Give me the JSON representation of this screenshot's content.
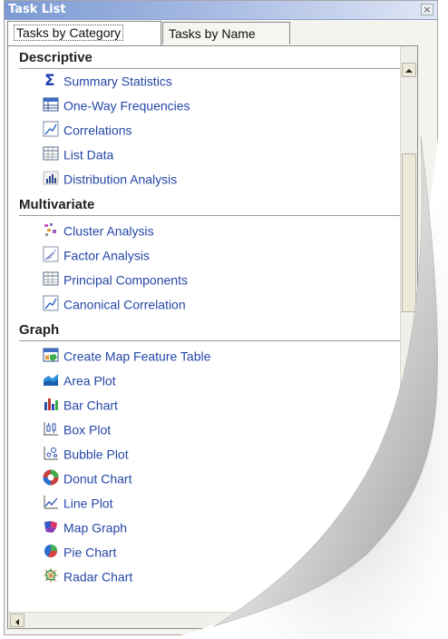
{
  "panel": {
    "title": "Task List",
    "close_glyph": "×"
  },
  "tabs": [
    {
      "label": "Tasks by Category",
      "active": true
    },
    {
      "label": "Tasks by Name",
      "active": false
    }
  ],
  "categories": [
    {
      "name": "Descriptive",
      "items": [
        {
          "label": "Summary Statistics",
          "icon": "sigma-icon"
        },
        {
          "label": "One-Way Frequencies",
          "icon": "table-icon"
        },
        {
          "label": "Correlations",
          "icon": "correlation-icon"
        },
        {
          "label": "List Data",
          "icon": "list-data-icon"
        },
        {
          "label": "Distribution Analysis",
          "icon": "histogram-icon"
        }
      ]
    },
    {
      "name": "Multivariate",
      "items": [
        {
          "label": "Cluster Analysis",
          "icon": "cluster-icon"
        },
        {
          "label": "Factor Analysis",
          "icon": "factor-icon"
        },
        {
          "label": "Principal Components",
          "icon": "components-icon"
        },
        {
          "label": "Canonical Correlation",
          "icon": "canonical-icon"
        }
      ]
    },
    {
      "name": "Graph",
      "items": [
        {
          "label": "Create Map Feature Table",
          "icon": "map-table-icon"
        },
        {
          "label": "Area Plot",
          "icon": "area-plot-icon"
        },
        {
          "label": "Bar Chart",
          "icon": "bar-chart-icon"
        },
        {
          "label": "Box Plot",
          "icon": "box-plot-icon"
        },
        {
          "label": "Bubble Plot",
          "icon": "bubble-plot-icon"
        },
        {
          "label": "Donut Chart",
          "icon": "donut-chart-icon"
        },
        {
          "label": "Line Plot",
          "icon": "line-plot-icon"
        },
        {
          "label": "Map Graph",
          "icon": "map-graph-icon"
        },
        {
          "label": "Pie Chart",
          "icon": "pie-chart-icon"
        },
        {
          "label": "Radar Chart",
          "icon": "radar-chart-icon"
        }
      ]
    }
  ],
  "colors": {
    "link": "#2547a7",
    "header_text": "#222222",
    "title_bar": "#7b9ad3"
  }
}
